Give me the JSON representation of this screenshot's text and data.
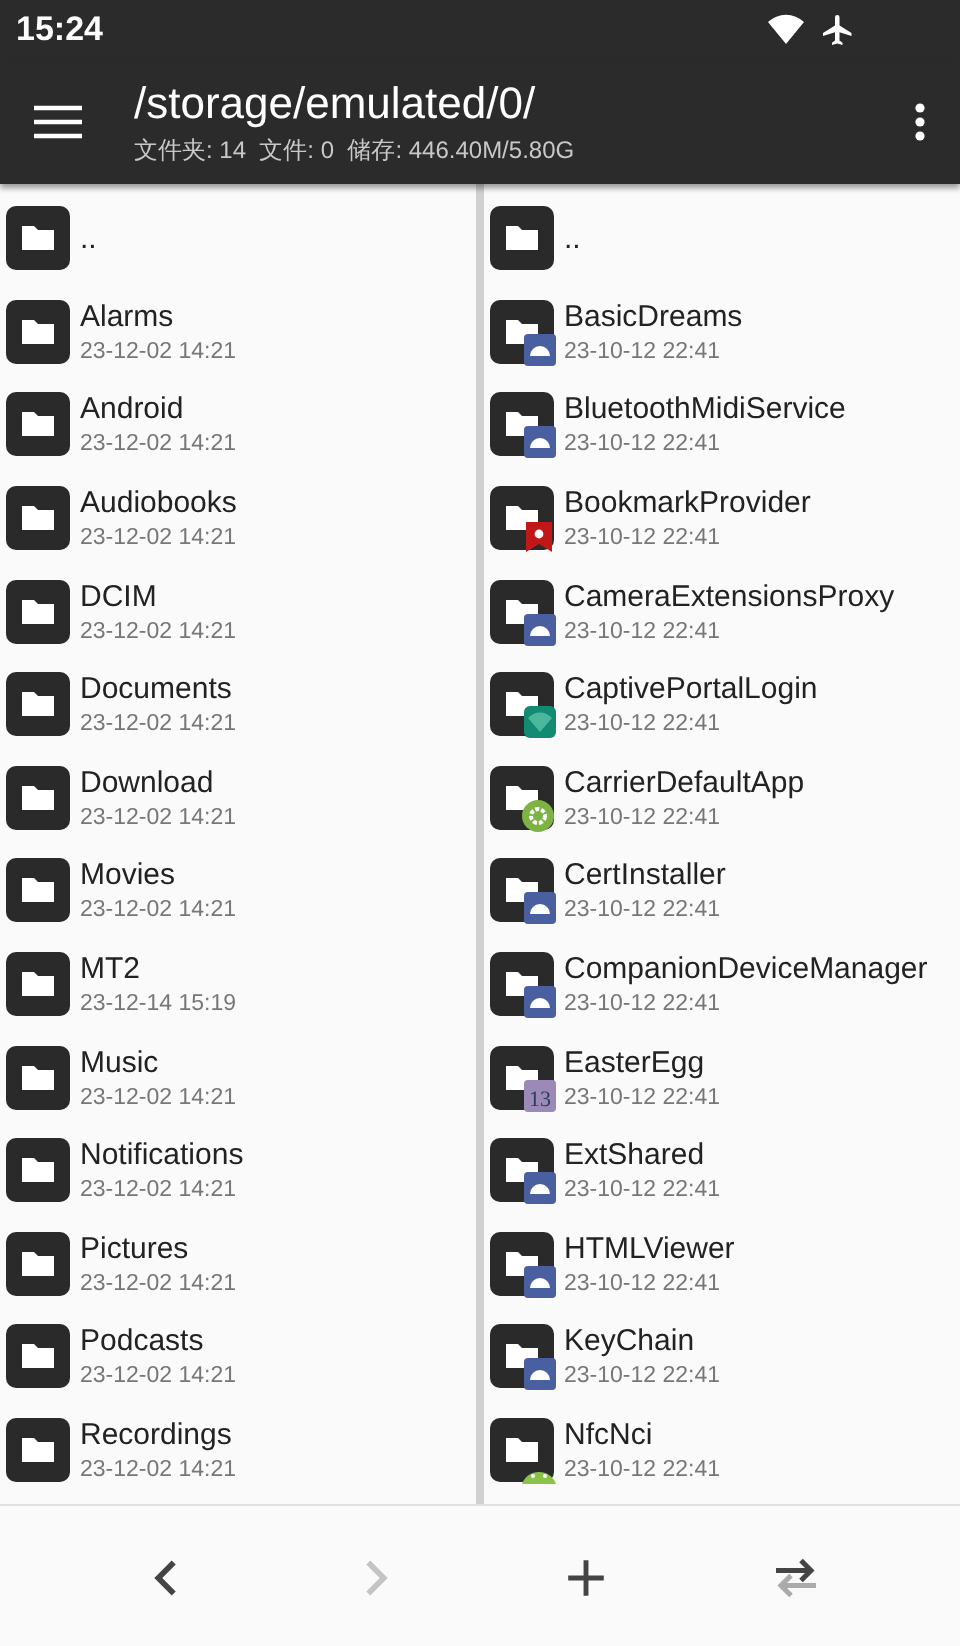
{
  "status_bar": {
    "time": "15:24"
  },
  "toolbar": {
    "path": "/storage/emulated/0/",
    "summary": "文件夹: 14  文件: 0  储存: 446.40M/5.80G"
  },
  "panes": [
    {
      "items": [
        {
          "kind": "folder",
          "name": ".."
        },
        {
          "kind": "folder",
          "name": "Alarms",
          "date": "23-12-02 14:21"
        },
        {
          "kind": "folder",
          "name": "Android",
          "date": "23-12-02 14:21"
        },
        {
          "kind": "folder",
          "name": "Audiobooks",
          "date": "23-12-02 14:21"
        },
        {
          "kind": "folder",
          "name": "DCIM",
          "date": "23-12-02 14:21"
        },
        {
          "kind": "folder",
          "name": "Documents",
          "date": "23-12-02 14:21"
        },
        {
          "kind": "folder",
          "name": "Download",
          "date": "23-12-02 14:21"
        },
        {
          "kind": "folder",
          "name": "Movies",
          "date": "23-12-02 14:21"
        },
        {
          "kind": "folder",
          "name": "MT2",
          "date": "23-12-14 15:19"
        },
        {
          "kind": "folder",
          "name": "Music",
          "date": "23-12-02 14:21"
        },
        {
          "kind": "folder",
          "name": "Notifications",
          "date": "23-12-02 14:21"
        },
        {
          "kind": "folder",
          "name": "Pictures",
          "date": "23-12-02 14:21"
        },
        {
          "kind": "folder",
          "name": "Podcasts",
          "date": "23-12-02 14:21"
        },
        {
          "kind": "folder",
          "name": "Recordings",
          "date": "23-12-02 14:21"
        }
      ]
    },
    {
      "items": [
        {
          "kind": "folder",
          "name": ".."
        },
        {
          "kind": "android",
          "name": "BasicDreams",
          "date": "23-10-12 22:41"
        },
        {
          "kind": "android",
          "name": "BluetoothMidiService",
          "date": "23-10-12 22:41"
        },
        {
          "kind": "bookmark",
          "name": "BookmarkProvider",
          "date": "23-10-12 22:41"
        },
        {
          "kind": "android",
          "name": "CameraExtensionsProxy",
          "date": "23-10-12 22:41"
        },
        {
          "kind": "wifi",
          "name": "CaptivePortalLogin",
          "date": "23-10-12 22:41"
        },
        {
          "kind": "gear",
          "name": "CarrierDefaultApp",
          "date": "23-10-12 22:41"
        },
        {
          "kind": "android",
          "name": "CertInstaller",
          "date": "23-10-12 22:41"
        },
        {
          "kind": "android",
          "name": "CompanionDeviceManager",
          "date": "23-10-12 22:41"
        },
        {
          "kind": "number",
          "name": "EasterEgg",
          "date": "23-10-12 22:41",
          "badge_text": "13"
        },
        {
          "kind": "android",
          "name": "ExtShared",
          "date": "23-10-12 22:41"
        },
        {
          "kind": "android",
          "name": "HTMLViewer",
          "date": "23-10-12 22:41"
        },
        {
          "kind": "android",
          "name": "KeyChain",
          "date": "23-10-12 22:41"
        },
        {
          "kind": "android-green",
          "name": "NfcNci",
          "date": "23-10-12 22:41"
        }
      ]
    }
  ],
  "bottom_bar": [
    {
      "kind": "back",
      "disabled": false
    },
    {
      "kind": "forward",
      "disabled": true
    },
    {
      "kind": "add",
      "disabled": false
    },
    {
      "kind": "swap",
      "disabled": false
    }
  ]
}
